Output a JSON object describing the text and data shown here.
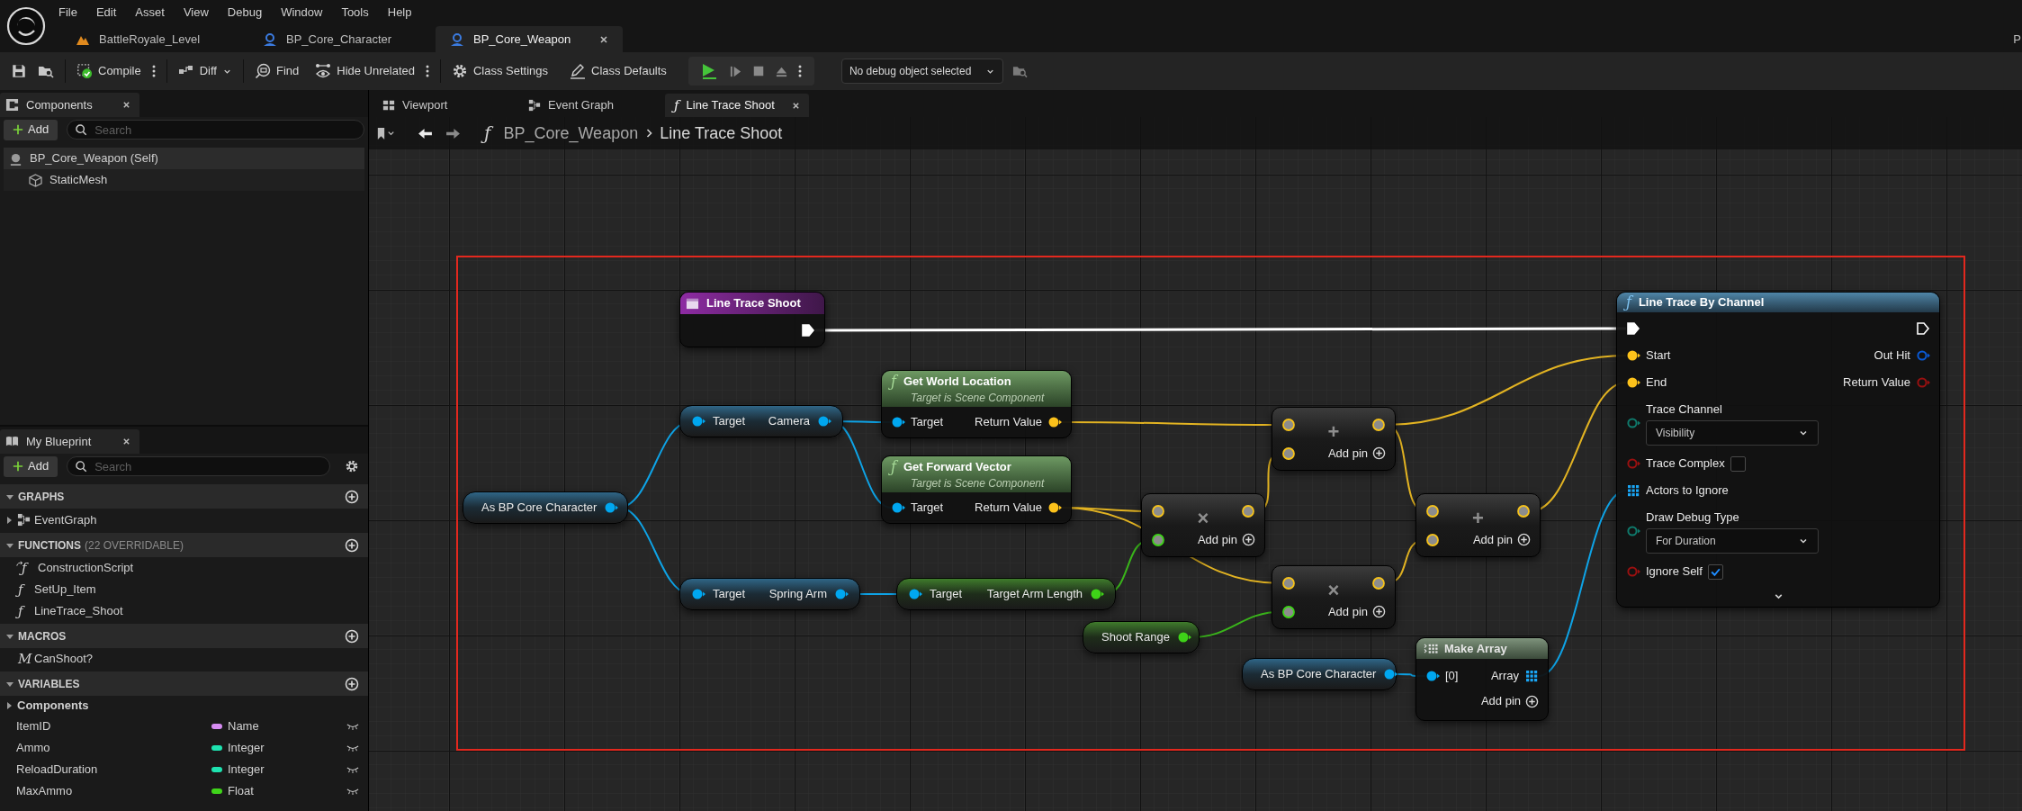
{
  "menu": [
    "File",
    "Edit",
    "Asset",
    "View",
    "Debug",
    "Window",
    "Tools",
    "Help"
  ],
  "document_tabs": [
    {
      "label": "BattleRoyale_Level",
      "kind": "level",
      "selected": false
    },
    {
      "label": "BP_Core_Character",
      "kind": "blueprint",
      "selected": false
    },
    {
      "label": "BP_Core_Weapon",
      "kind": "blueprint",
      "selected": true
    }
  ],
  "edge_text": "P",
  "toolbar": {
    "compile": "Compile",
    "diff": "Diff",
    "find": "Find",
    "hide_unrelated": "Hide Unrelated",
    "class_settings": "Class Settings",
    "class_defaults": "Class Defaults",
    "debug_object": "No debug object selected"
  },
  "components": {
    "title": "Components",
    "add": "Add",
    "search_placeholder": "Search",
    "tree": [
      {
        "label": "BP_Core_Weapon (Self)",
        "kind": "actor",
        "selected": true,
        "children": [
          {
            "label": "StaticMesh",
            "kind": "mesh",
            "selected": false
          }
        ]
      }
    ]
  },
  "my_blueprint": {
    "title": "My Blueprint",
    "add": "Add",
    "search_placeholder": "Search",
    "sections": [
      {
        "title": "GRAPHS",
        "expanded": true,
        "items": [
          {
            "label": "EventGraph",
            "kind": "graph",
            "expanded": false
          }
        ]
      },
      {
        "title": "FUNCTIONS",
        "note": "(22 OVERRIDABLE)",
        "expanded": true,
        "items": [
          {
            "label": "ConstructionScript",
            "kind": "construction",
            "glyph": "ƒ"
          },
          {
            "label": "SetUp_Item",
            "kind": "function",
            "glyph": "ƒ"
          },
          {
            "label": "LineTrace_Shoot",
            "kind": "function",
            "glyph": "ƒ"
          }
        ]
      },
      {
        "title": "MACROS",
        "expanded": true,
        "items": [
          {
            "label": "CanShoot?",
            "kind": "macro",
            "glyph": "M"
          }
        ]
      },
      {
        "title": "VARIABLES",
        "expanded": true,
        "items": [
          {
            "label": "Components",
            "kind": "category",
            "expanded": false
          },
          {
            "label": "ItemID",
            "kind": "variable",
            "type": "Name",
            "color": "#d68cf2"
          },
          {
            "label": "Ammo",
            "kind": "variable",
            "type": "Integer",
            "color": "#1ee3b0"
          },
          {
            "label": "ReloadDuration",
            "kind": "variable",
            "type": "Integer",
            "color": "#1ee3b0"
          },
          {
            "label": "MaxAmmo",
            "kind": "variable",
            "type": "Float",
            "color": "#3fd41a"
          }
        ]
      }
    ]
  },
  "graph_tabs": [
    {
      "label": "Viewport",
      "kind": "viewport",
      "selected": false
    },
    {
      "label": "Event Graph",
      "kind": "graph",
      "selected": false
    },
    {
      "label": "Line Trace Shoot",
      "kind": "function",
      "glyph": "ƒ",
      "selected": true
    }
  ],
  "breadcrumb": {
    "glyph": "ƒ",
    "path": [
      "BP_Core_Weapon",
      "Line Trace Shoot"
    ]
  },
  "graph": {
    "nodes": [
      {
        "kind": "event",
        "title": "Line Trace Shoot",
        "outputs": [
          {
            "kind": "exec",
            "connected": true
          }
        ]
      },
      {
        "kind": "getter",
        "outputs": [
          {
            "label": "As BP Core Character",
            "kind": "object",
            "connected": true
          }
        ]
      },
      {
        "kind": "getter",
        "inputs": [
          {
            "label": "Target",
            "kind": "object",
            "connected": true
          }
        ],
        "outputs": [
          {
            "label": "Camera",
            "kind": "object",
            "connected": true
          }
        ]
      },
      {
        "kind": "function",
        "pure": true,
        "glyph": "ƒ",
        "title": "Get World Location",
        "subtitle": "Target is Scene Component",
        "inputs": [
          {
            "label": "Target",
            "kind": "object",
            "connected": true
          }
        ],
        "outputs": [
          {
            "label": "Return Value",
            "kind": "vector",
            "connected": true
          }
        ]
      },
      {
        "kind": "function",
        "pure": true,
        "glyph": "ƒ",
        "title": "Get Forward Vector",
        "subtitle": "Target is Scene Component",
        "inputs": [
          {
            "label": "Target",
            "kind": "object",
            "connected": true
          }
        ],
        "outputs": [
          {
            "label": "Return Value",
            "kind": "vector",
            "connected": true
          }
        ]
      },
      {
        "kind": "getter",
        "inputs": [
          {
            "label": "Target",
            "kind": "object",
            "connected": true
          }
        ],
        "outputs": [
          {
            "label": "Spring Arm",
            "kind": "object",
            "connected": true
          }
        ]
      },
      {
        "kind": "getter",
        "inputs": [
          {
            "label": "Target",
            "kind": "object",
            "connected": true
          }
        ],
        "outputs": [
          {
            "label": "Target Arm Length",
            "kind": "float",
            "connected": true
          }
        ]
      },
      {
        "kind": "getter",
        "outputs": [
          {
            "label": "Shoot Range",
            "kind": "float",
            "connected": true
          }
        ]
      },
      {
        "kind": "math",
        "symbol": "×",
        "add_pin": "Add pin",
        "inputs": [
          {
            "kind": "wild_vector",
            "connected": true
          },
          {
            "kind": "wild_float",
            "connected": true
          }
        ],
        "outputs": [
          {
            "kind": "wild_vector",
            "connected": true
          }
        ]
      },
      {
        "kind": "math",
        "symbol": "+",
        "add_pin": "Add pin",
        "inputs": [
          {
            "kind": "wild_vector",
            "connected": true
          },
          {
            "kind": "wild_vector",
            "connected": true
          }
        ],
        "outputs": [
          {
            "kind": "wild_vector",
            "connected": true
          }
        ]
      },
      {
        "kind": "math",
        "symbol": "×",
        "add_pin": "Add pin",
        "inputs": [
          {
            "kind": "wild_vector",
            "connected": true
          },
          {
            "kind": "wild_float",
            "connected": true
          }
        ],
        "outputs": [
          {
            "kind": "wild_vector",
            "connected": true
          }
        ]
      },
      {
        "kind": "math",
        "symbol": "+",
        "add_pin": "Add pin",
        "inputs": [
          {
            "kind": "wild_vector",
            "connected": true
          },
          {
            "kind": "wild_vector",
            "connected": true
          }
        ],
        "outputs": [
          {
            "kind": "wild_vector",
            "connected": true
          }
        ]
      },
      {
        "kind": "getter",
        "outputs": [
          {
            "label": "As BP Core Character",
            "kind": "object",
            "connected": true
          }
        ]
      },
      {
        "kind": "make_array",
        "title": "Make Array",
        "add_pin": "Add pin",
        "inputs": [
          {
            "label": "[0]",
            "kind": "object",
            "connected": true
          }
        ],
        "outputs": [
          {
            "label": "Array",
            "kind": "array",
            "connected": true
          }
        ]
      },
      {
        "kind": "function",
        "pure": false,
        "glyph": "ƒ",
        "title": "Line Trace By Channel",
        "advanced_expanded": false,
        "inputs": [
          {
            "kind": "exec",
            "connected": true
          },
          {
            "label": "Start",
            "kind": "vector",
            "connected": true
          },
          {
            "label": "End",
            "kind": "vector",
            "connected": true
          },
          {
            "label": "Trace Channel",
            "kind": "enum",
            "connected": false,
            "value": "Visibility"
          },
          {
            "label": "Trace Complex",
            "kind": "bool",
            "connected": false,
            "checked": false
          },
          {
            "label": "Actors to Ignore",
            "kind": "array",
            "connected": true
          },
          {
            "label": "Draw Debug Type",
            "kind": "enum",
            "connected": false,
            "value": "For Duration"
          },
          {
            "label": "Ignore Self",
            "kind": "bool",
            "connected": false,
            "checked": true
          }
        ],
        "outputs": [
          {
            "kind": "exec",
            "connected": false
          },
          {
            "label": "Out Hit",
            "kind": "struct",
            "connected": false
          },
          {
            "label": "Return Value",
            "kind": "bool",
            "connected": false
          }
        ]
      }
    ]
  }
}
